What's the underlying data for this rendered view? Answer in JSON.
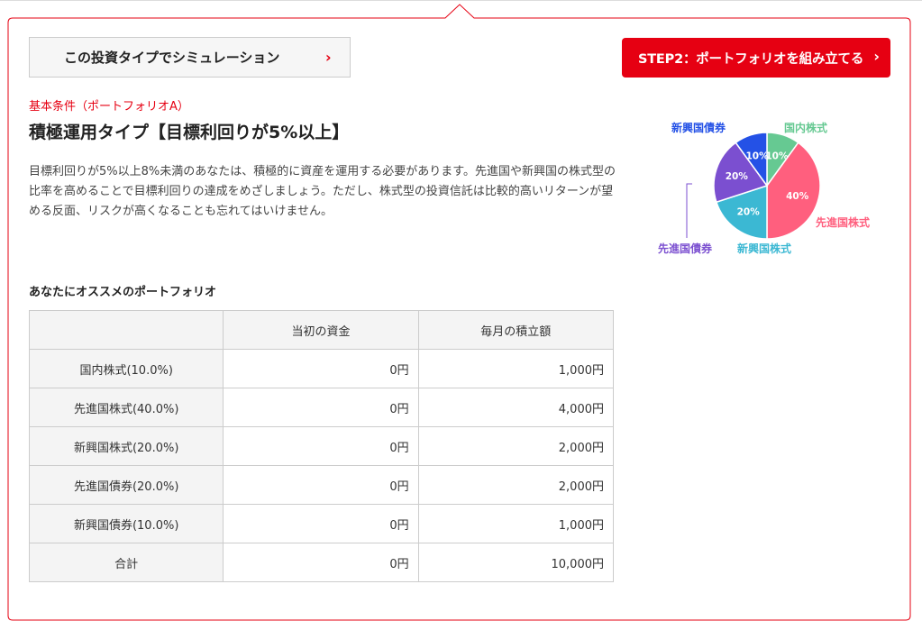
{
  "actions": {
    "simulate_label": "この投資タイプでシミュレーション",
    "simulate_chevron": "›",
    "step2_label": "STEP2：ポートフォリオを組み立てる",
    "step2_chevron": "›"
  },
  "condition": {
    "label": "基本条件（ポートフォリオA）",
    "title": "積極運用タイプ【目標利回りが5%以上】",
    "description": "目標利回りが5%以上8%未満のあなたは、積極的に資産を運用する必要があります。先進国や新興国の株式型の比率を高めることで目標利回りの達成をめざしましょう。ただし、株式型の投資信託は比較的高いリターンが望める反面、リスクが高くなることも忘れてはいけません。"
  },
  "recommendation": {
    "title": "あなたにオススメのポートフォリオ",
    "columns": [
      "",
      "当初の資金",
      "毎月の積立額"
    ],
    "rows": [
      {
        "name": "国内株式(10.0%)",
        "initial": "0円",
        "monthly": "1,000円"
      },
      {
        "name": "先進国株式(40.0%)",
        "initial": "0円",
        "monthly": "4,000円"
      },
      {
        "name": "新興国株式(20.0%)",
        "initial": "0円",
        "monthly": "2,000円"
      },
      {
        "name": "先進国債券(20.0%)",
        "initial": "0円",
        "monthly": "2,000円"
      },
      {
        "name": "新興国債券(10.0%)",
        "initial": "0円",
        "monthly": "1,000円"
      }
    ],
    "total": {
      "name": "合計",
      "initial": "0円",
      "monthly": "10,000円"
    }
  },
  "chart_data": {
    "type": "pie",
    "slices": [
      {
        "label": "国内株式",
        "value": 10,
        "display": "10%",
        "color": "#66c992"
      },
      {
        "label": "先進国株式",
        "value": 40,
        "display": "40%",
        "color": "#ff5f7e"
      },
      {
        "label": "新興国株式",
        "value": 20,
        "display": "20%",
        "color": "#3bb8d3"
      },
      {
        "label": "先進国債券",
        "value": 20,
        "display": "20%",
        "color": "#7b4fd0"
      },
      {
        "label": "新興国債券",
        "value": 10,
        "display": "10%",
        "color": "#2451e6"
      }
    ]
  },
  "colors": {
    "accent": "#e60012",
    "border": "#cccccc",
    "header_bg": "#f4f4f4"
  }
}
